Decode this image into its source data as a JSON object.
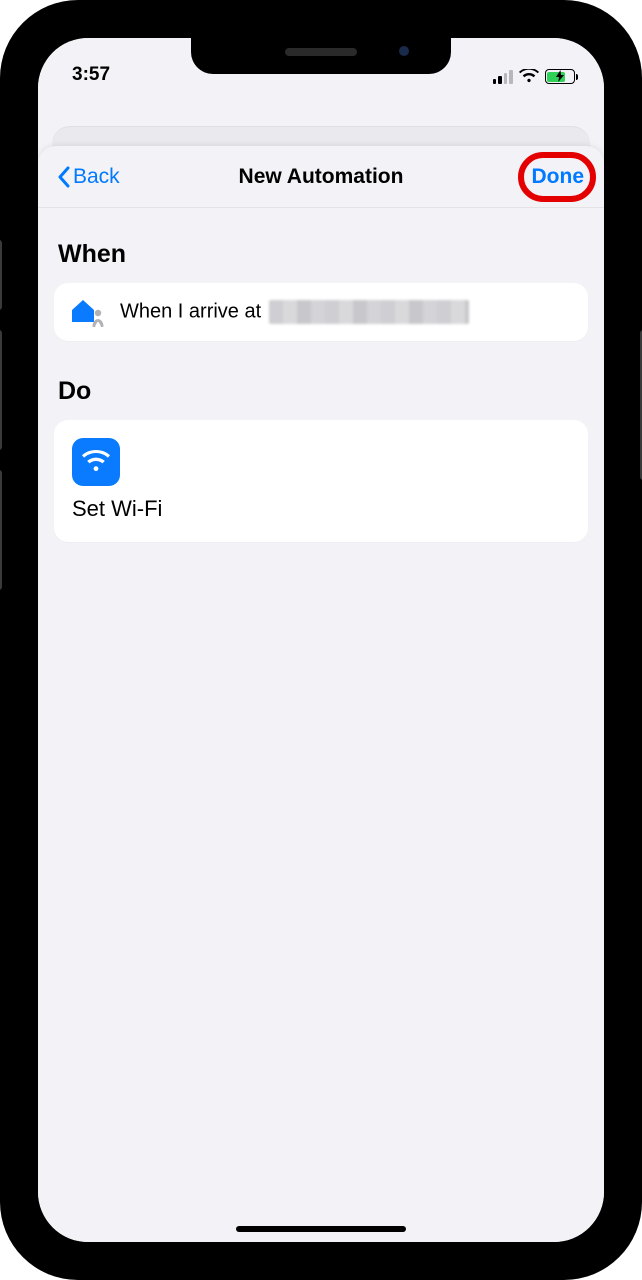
{
  "status": {
    "time": "3:57"
  },
  "nav": {
    "back_label": "Back",
    "title": "New Automation",
    "done_label": "Done"
  },
  "sections": {
    "when_heading": "When",
    "do_heading": "Do"
  },
  "when": {
    "trigger_prefix": "When I arrive at "
  },
  "do": {
    "action_label": "Set Wi-Fi"
  }
}
